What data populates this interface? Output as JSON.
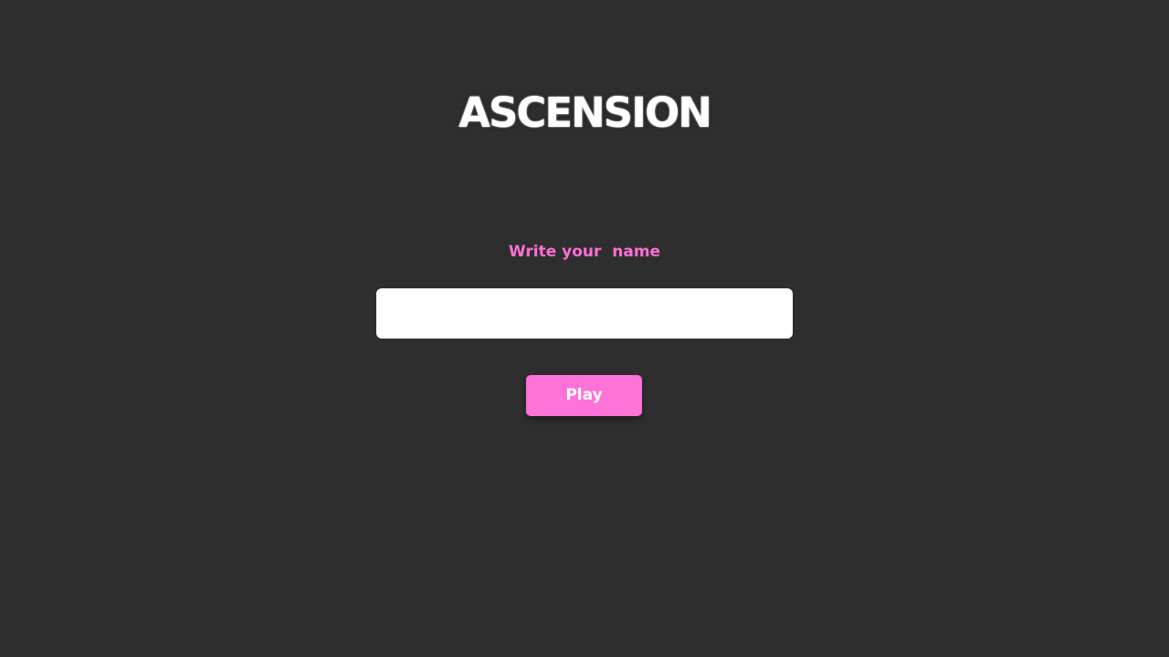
{
  "app": {
    "title": "ASCENSION"
  },
  "form": {
    "name_label": "Write your  name",
    "name_value": "",
    "name_placeholder": "",
    "play_label": "Play"
  },
  "colors": {
    "background": "#2e2e2e",
    "accent": "#ff72d8",
    "label": "#ff6fd6",
    "input_background": "#ffffff",
    "button_text": "#ffffff"
  }
}
